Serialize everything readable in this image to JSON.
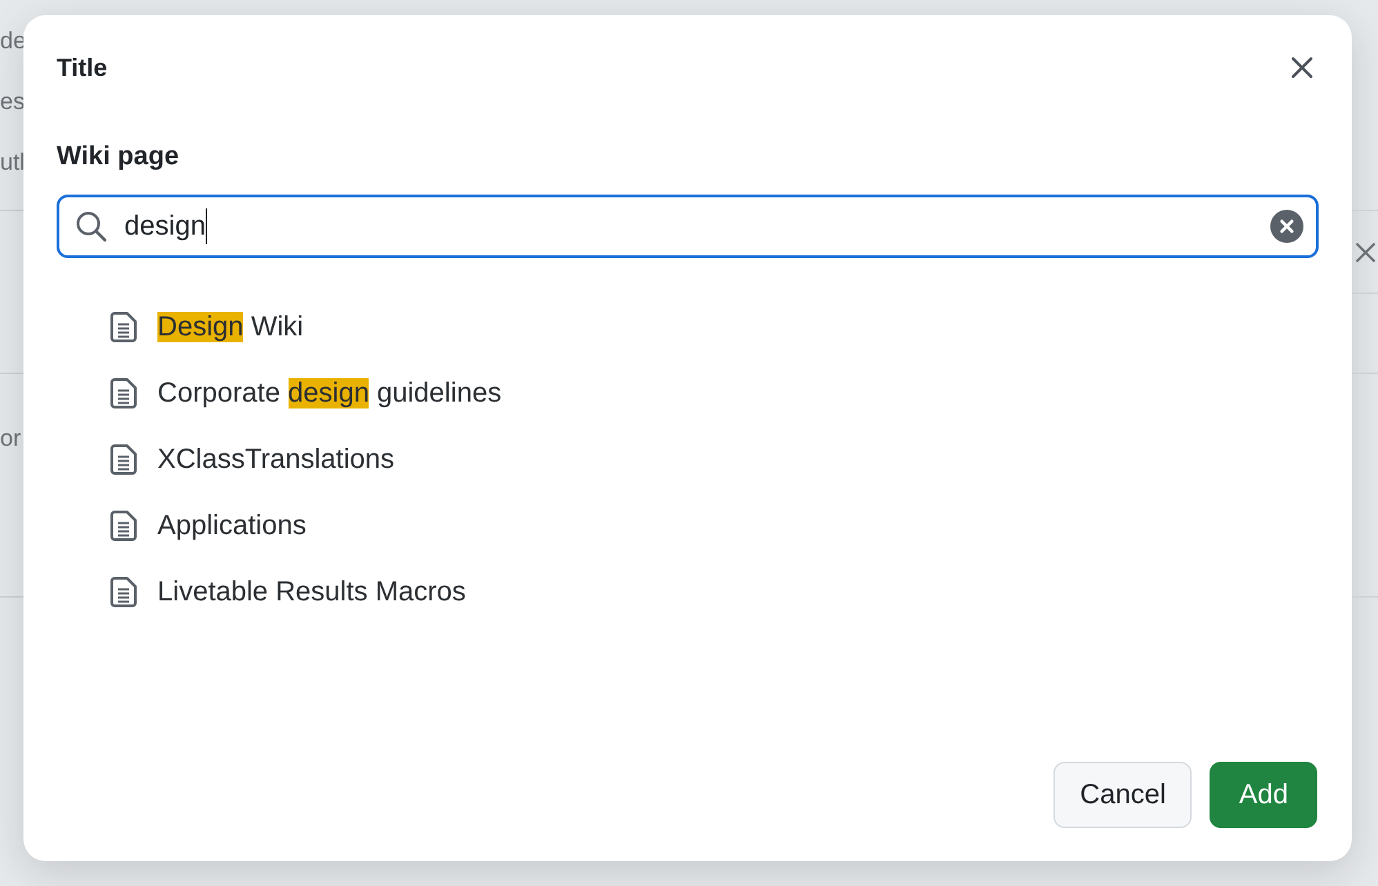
{
  "background": {
    "left_edge_text": [
      "de",
      "es",
      "utl",
      "or"
    ]
  },
  "dialog": {
    "title": "Title",
    "field_label": "Wiki page",
    "search": {
      "value": "design"
    },
    "results": [
      {
        "parts": [
          {
            "text": "Design",
            "match": true
          },
          {
            "text": " Wiki",
            "match": false
          }
        ]
      },
      {
        "parts": [
          {
            "text": "Corporate ",
            "match": false
          },
          {
            "text": "design",
            "match": true
          },
          {
            "text": " guidelines",
            "match": false
          }
        ]
      },
      {
        "parts": [
          {
            "text": "XClassTranslations",
            "match": false
          }
        ]
      },
      {
        "parts": [
          {
            "text": "Applications",
            "match": false
          }
        ]
      },
      {
        "parts": [
          {
            "text": "Livetable Results Macros",
            "match": false
          }
        ]
      }
    ],
    "buttons": [
      {
        "label": "Cancel",
        "kind": "secondary"
      },
      {
        "label": "Add",
        "kind": "primary"
      }
    ]
  }
}
